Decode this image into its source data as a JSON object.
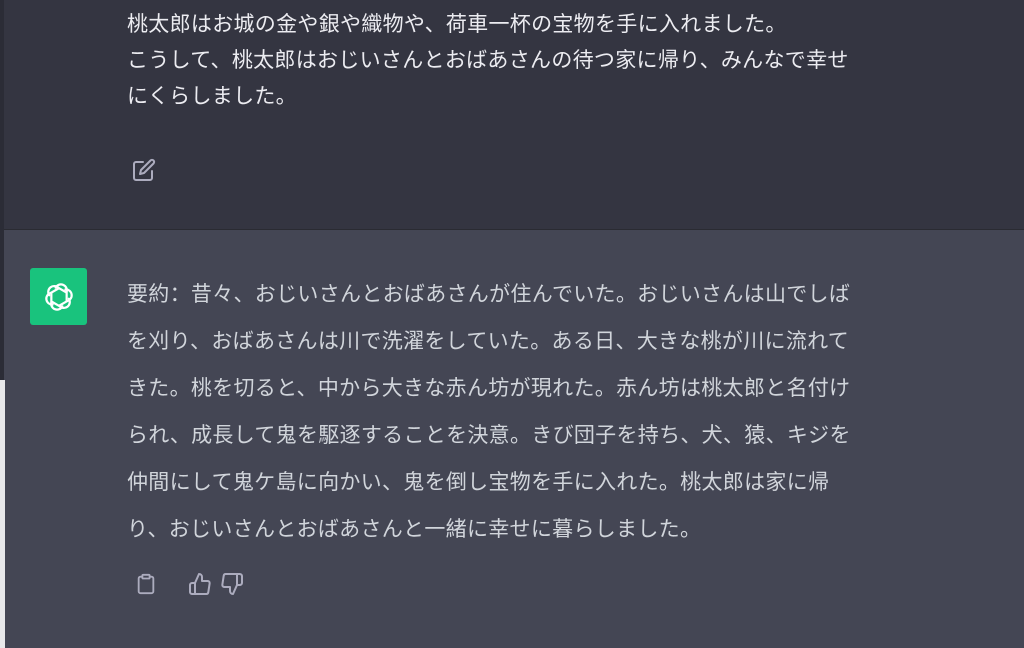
{
  "conversation": {
    "user_message": {
      "lines": [
        "桃太郎はお城の金や銀や織物や、荷車一杯の宝物を手に入れました。",
        "こうして、桃太郎はおじいさんとおばあさんの待つ家に帰り、みんなで幸せ",
        "にくらしました。"
      ],
      "edit_icon": "edit-icon"
    },
    "assistant_message": {
      "avatar_icon": "openai-logo-icon",
      "avatar_color": "#19c37d",
      "lines": [
        "要約：昔々、おじいさんとおばあさんが住んでいた。おじいさんは山でしば",
        "を刈り、おばあさんは川で洗濯をしていた。ある日、大きな桃が川に流れて",
        "きた。桃を切ると、中から大きな赤ん坊が現れた。赤ん坊は桃太郎と名付け",
        "られ、成長して鬼を駆逐することを決意。きび団子を持ち、犬、猿、キジを",
        "仲間にして鬼ケ島に向かい、鬼を倒し宝物を手に入れた。桃太郎は家に帰",
        "り、おじいさんとおばあさんと一緒に幸せに暮らしました。"
      ],
      "actions": [
        "clipboard-icon",
        "thumbs-up-icon",
        "thumbs-down-icon"
      ]
    }
  },
  "colors": {
    "user_bg": "#343541",
    "assistant_bg": "#444654",
    "text": "#ececf1",
    "icon": "#acacbe"
  }
}
